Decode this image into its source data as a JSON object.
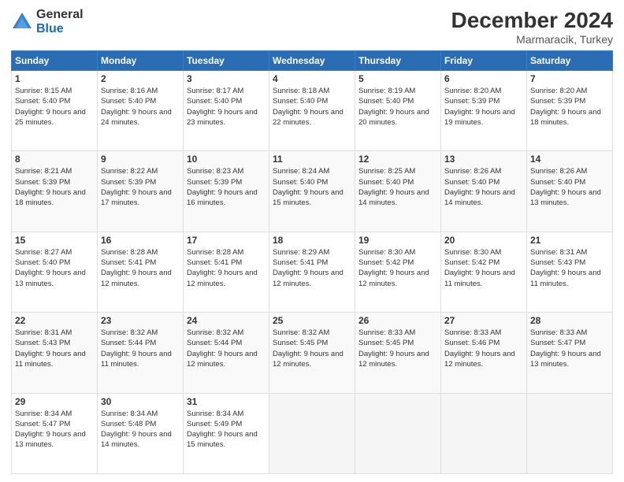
{
  "logo": {
    "general": "General",
    "blue": "Blue"
  },
  "header": {
    "month": "December 2024",
    "location": "Marmaracik, Turkey"
  },
  "weekdays": [
    "Sunday",
    "Monday",
    "Tuesday",
    "Wednesday",
    "Thursday",
    "Friday",
    "Saturday"
  ],
  "weeks": [
    [
      {
        "day": "1",
        "sunrise": "Sunrise: 8:15 AM",
        "sunset": "Sunset: 5:40 PM",
        "daylight": "Daylight: 9 hours and 25 minutes."
      },
      {
        "day": "2",
        "sunrise": "Sunrise: 8:16 AM",
        "sunset": "Sunset: 5:40 PM",
        "daylight": "Daylight: 9 hours and 24 minutes."
      },
      {
        "day": "3",
        "sunrise": "Sunrise: 8:17 AM",
        "sunset": "Sunset: 5:40 PM",
        "daylight": "Daylight: 9 hours and 23 minutes."
      },
      {
        "day": "4",
        "sunrise": "Sunrise: 8:18 AM",
        "sunset": "Sunset: 5:40 PM",
        "daylight": "Daylight: 9 hours and 22 minutes."
      },
      {
        "day": "5",
        "sunrise": "Sunrise: 8:19 AM",
        "sunset": "Sunset: 5:40 PM",
        "daylight": "Daylight: 9 hours and 20 minutes."
      },
      {
        "day": "6",
        "sunrise": "Sunrise: 8:20 AM",
        "sunset": "Sunset: 5:39 PM",
        "daylight": "Daylight: 9 hours and 19 minutes."
      },
      {
        "day": "7",
        "sunrise": "Sunrise: 8:20 AM",
        "sunset": "Sunset: 5:39 PM",
        "daylight": "Daylight: 9 hours and 18 minutes."
      }
    ],
    [
      {
        "day": "8",
        "sunrise": "Sunrise: 8:21 AM",
        "sunset": "Sunset: 5:39 PM",
        "daylight": "Daylight: 9 hours and 18 minutes."
      },
      {
        "day": "9",
        "sunrise": "Sunrise: 8:22 AM",
        "sunset": "Sunset: 5:39 PM",
        "daylight": "Daylight: 9 hours and 17 minutes."
      },
      {
        "day": "10",
        "sunrise": "Sunrise: 8:23 AM",
        "sunset": "Sunset: 5:39 PM",
        "daylight": "Daylight: 9 hours and 16 minutes."
      },
      {
        "day": "11",
        "sunrise": "Sunrise: 8:24 AM",
        "sunset": "Sunset: 5:40 PM",
        "daylight": "Daylight: 9 hours and 15 minutes."
      },
      {
        "day": "12",
        "sunrise": "Sunrise: 8:25 AM",
        "sunset": "Sunset: 5:40 PM",
        "daylight": "Daylight: 9 hours and 14 minutes."
      },
      {
        "day": "13",
        "sunrise": "Sunrise: 8:26 AM",
        "sunset": "Sunset: 5:40 PM",
        "daylight": "Daylight: 9 hours and 14 minutes."
      },
      {
        "day": "14",
        "sunrise": "Sunrise: 8:26 AM",
        "sunset": "Sunset: 5:40 PM",
        "daylight": "Daylight: 9 hours and 13 minutes."
      }
    ],
    [
      {
        "day": "15",
        "sunrise": "Sunrise: 8:27 AM",
        "sunset": "Sunset: 5:40 PM",
        "daylight": "Daylight: 9 hours and 13 minutes."
      },
      {
        "day": "16",
        "sunrise": "Sunrise: 8:28 AM",
        "sunset": "Sunset: 5:41 PM",
        "daylight": "Daylight: 9 hours and 12 minutes."
      },
      {
        "day": "17",
        "sunrise": "Sunrise: 8:28 AM",
        "sunset": "Sunset: 5:41 PM",
        "daylight": "Daylight: 9 hours and 12 minutes."
      },
      {
        "day": "18",
        "sunrise": "Sunrise: 8:29 AM",
        "sunset": "Sunset: 5:41 PM",
        "daylight": "Daylight: 9 hours and 12 minutes."
      },
      {
        "day": "19",
        "sunrise": "Sunrise: 8:30 AM",
        "sunset": "Sunset: 5:42 PM",
        "daylight": "Daylight: 9 hours and 12 minutes."
      },
      {
        "day": "20",
        "sunrise": "Sunrise: 8:30 AM",
        "sunset": "Sunset: 5:42 PM",
        "daylight": "Daylight: 9 hours and 11 minutes."
      },
      {
        "day": "21",
        "sunrise": "Sunrise: 8:31 AM",
        "sunset": "Sunset: 5:43 PM",
        "daylight": "Daylight: 9 hours and 11 minutes."
      }
    ],
    [
      {
        "day": "22",
        "sunrise": "Sunrise: 8:31 AM",
        "sunset": "Sunset: 5:43 PM",
        "daylight": "Daylight: 9 hours and 11 minutes."
      },
      {
        "day": "23",
        "sunrise": "Sunrise: 8:32 AM",
        "sunset": "Sunset: 5:44 PM",
        "daylight": "Daylight: 9 hours and 11 minutes."
      },
      {
        "day": "24",
        "sunrise": "Sunrise: 8:32 AM",
        "sunset": "Sunset: 5:44 PM",
        "daylight": "Daylight: 9 hours and 12 minutes."
      },
      {
        "day": "25",
        "sunrise": "Sunrise: 8:32 AM",
        "sunset": "Sunset: 5:45 PM",
        "daylight": "Daylight: 9 hours and 12 minutes."
      },
      {
        "day": "26",
        "sunrise": "Sunrise: 8:33 AM",
        "sunset": "Sunset: 5:45 PM",
        "daylight": "Daylight: 9 hours and 12 minutes."
      },
      {
        "day": "27",
        "sunrise": "Sunrise: 8:33 AM",
        "sunset": "Sunset: 5:46 PM",
        "daylight": "Daylight: 9 hours and 12 minutes."
      },
      {
        "day": "28",
        "sunrise": "Sunrise: 8:33 AM",
        "sunset": "Sunset: 5:47 PM",
        "daylight": "Daylight: 9 hours and 13 minutes."
      }
    ],
    [
      {
        "day": "29",
        "sunrise": "Sunrise: 8:34 AM",
        "sunset": "Sunset: 5:47 PM",
        "daylight": "Daylight: 9 hours and 13 minutes."
      },
      {
        "day": "30",
        "sunrise": "Sunrise: 8:34 AM",
        "sunset": "Sunset: 5:48 PM",
        "daylight": "Daylight: 9 hours and 14 minutes."
      },
      {
        "day": "31",
        "sunrise": "Sunrise: 8:34 AM",
        "sunset": "Sunset: 5:49 PM",
        "daylight": "Daylight: 9 hours and 15 minutes."
      },
      null,
      null,
      null,
      null
    ]
  ]
}
